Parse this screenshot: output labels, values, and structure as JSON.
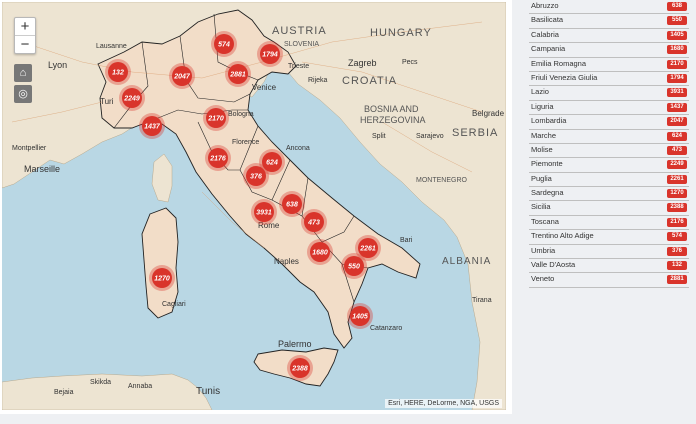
{
  "map": {
    "zoom_in": "+",
    "zoom_out": "−",
    "home_icon": "home-icon",
    "locate_icon": "locate-icon",
    "attribution": "Esri, HERE, DeLorme, NGA, USGS",
    "labels": {
      "austria": "AUSTRIA",
      "hungary": "HUNGARY",
      "slovenia": "SLOVENIA",
      "croatia": "CROATIA",
      "bosnia1": "BOSNIA AND",
      "bosnia2": "HERZEGOVINA",
      "serbia": "SERBIA",
      "montenegro": "MONTENEGRO",
      "albania": "ALBANIA",
      "zagreb": "Zagreb",
      "venice": "Venice",
      "florence": "Florence",
      "bologna": "Bologna",
      "ancona": "Ancona",
      "rome": "Rome",
      "naples": "Naples",
      "bari": "Bari",
      "palermo": "Palermo",
      "cagliari": "Cagliari",
      "catanzaro": "Catanzaro",
      "tunis": "Tunis",
      "marseille": "Marseille",
      "lyon": "Lyon",
      "montpellier": "Montpellier",
      "sarajevo": "Sarajevo",
      "belgrade": "Belgrade",
      "rijeka": "Rijeka",
      "split": "Split",
      "skikda": "Skikda",
      "annaba": "Annaba",
      "bejaia": "Bejaia",
      "tirana": "Tirana",
      "pecs": "Pecs",
      "lausanne": "Lausanne",
      "torino": "Turi",
      "trieste": "Trieste"
    },
    "colors": {
      "sea": "#b9d7e4",
      "land": "#ede4d2",
      "italy": "#f2ddc8",
      "marker": "#d9342b"
    }
  },
  "regions": [
    {
      "name": "Abruzzo",
      "count": "638"
    },
    {
      "name": "Basilicata",
      "count": "550"
    },
    {
      "name": "Calabria",
      "count": "1405"
    },
    {
      "name": "Campania",
      "count": "1680"
    },
    {
      "name": "Emilia Romagna",
      "count": "2170"
    },
    {
      "name": "Friuli Venezia Giulia",
      "count": "1794"
    },
    {
      "name": "Lazio",
      "count": "3931"
    },
    {
      "name": "Liguria",
      "count": "1437"
    },
    {
      "name": "Lombardia",
      "count": "2047"
    },
    {
      "name": "Marche",
      "count": "624"
    },
    {
      "name": "Molise",
      "count": "473"
    },
    {
      "name": "Piemonte",
      "count": "2249"
    },
    {
      "name": "Puglia",
      "count": "2261"
    },
    {
      "name": "Sardegna",
      "count": "1270"
    },
    {
      "name": "Sicilia",
      "count": "2388"
    },
    {
      "name": "Toscana",
      "count": "2176"
    },
    {
      "name": "Trentino Alto Adige",
      "count": "574"
    },
    {
      "name": "Umbria",
      "count": "376"
    },
    {
      "name": "Valle D'Aosta",
      "count": "132"
    },
    {
      "name": "Veneto",
      "count": "2881"
    }
  ]
}
